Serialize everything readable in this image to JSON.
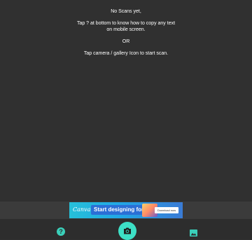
{
  "empty_state": {
    "line1": "No Scans yet,",
    "line2": "Tap ? at bottom to know how to copy any text",
    "line3": "on mobile screen.",
    "line4": "OR",
    "line5": "Tap camera / gallery Icon to start scan."
  },
  "ad": {
    "logo": "Canva",
    "headline": "Start designing for free",
    "cta": "Download now"
  },
  "bottom_nav": {
    "help_glyph": "?",
    "icons": [
      "help-icon",
      "camera-icon",
      "gallery-icon"
    ],
    "accent_color": "#3de0c6"
  }
}
